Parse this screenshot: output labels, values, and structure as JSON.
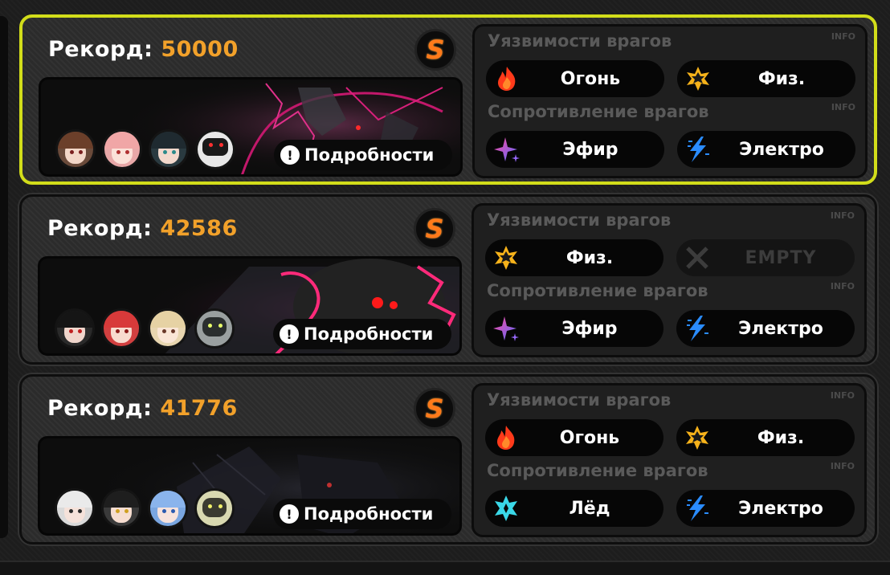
{
  "cards": [
    {
      "record_label": "Рекорд:",
      "record_value": "50000",
      "rank": "S",
      "details_label": "Подробности",
      "weak_title": "Уязвимости врагов",
      "resist_title": "Сопротивление врагов",
      "info_label": "INFO",
      "weak": [
        {
          "label": "Огонь",
          "icon": "fire-icon"
        },
        {
          "label": "Физ.",
          "icon": "physical-icon"
        }
      ],
      "resist": [
        {
          "label": "Эфир",
          "icon": "ether-icon"
        },
        {
          "label": "Электро",
          "icon": "electric-icon"
        }
      ]
    },
    {
      "record_label": "Рекорд:",
      "record_value": "42586",
      "rank": "S",
      "details_label": "Подробности",
      "weak_title": "Уязвимости врагов",
      "resist_title": "Сопротивление врагов",
      "info_label": "INFO",
      "weak": [
        {
          "label": "Физ.",
          "icon": "physical-icon"
        },
        {
          "label": "EMPTY",
          "icon": "empty-icon"
        }
      ],
      "resist": [
        {
          "label": "Эфир",
          "icon": "ether-icon"
        },
        {
          "label": "Электро",
          "icon": "electric-icon"
        }
      ]
    },
    {
      "record_label": "Рекорд:",
      "record_value": "41776",
      "rank": "S",
      "details_label": "Подробности",
      "weak_title": "Уязвимости врагов",
      "resist_title": "Сопротивление врагов",
      "info_label": "INFO",
      "weak": [
        {
          "label": "Огонь",
          "icon": "fire-icon"
        },
        {
          "label": "Физ.",
          "icon": "physical-icon"
        }
      ],
      "resist": [
        {
          "label": "Лёд",
          "icon": "ice-icon"
        },
        {
          "label": "Электро",
          "icon": "electric-icon"
        }
      ]
    }
  ],
  "colors": {
    "selected_border": "#d2dd1a",
    "record_value": "#f2a12a",
    "rank": "#ff7a1a"
  }
}
